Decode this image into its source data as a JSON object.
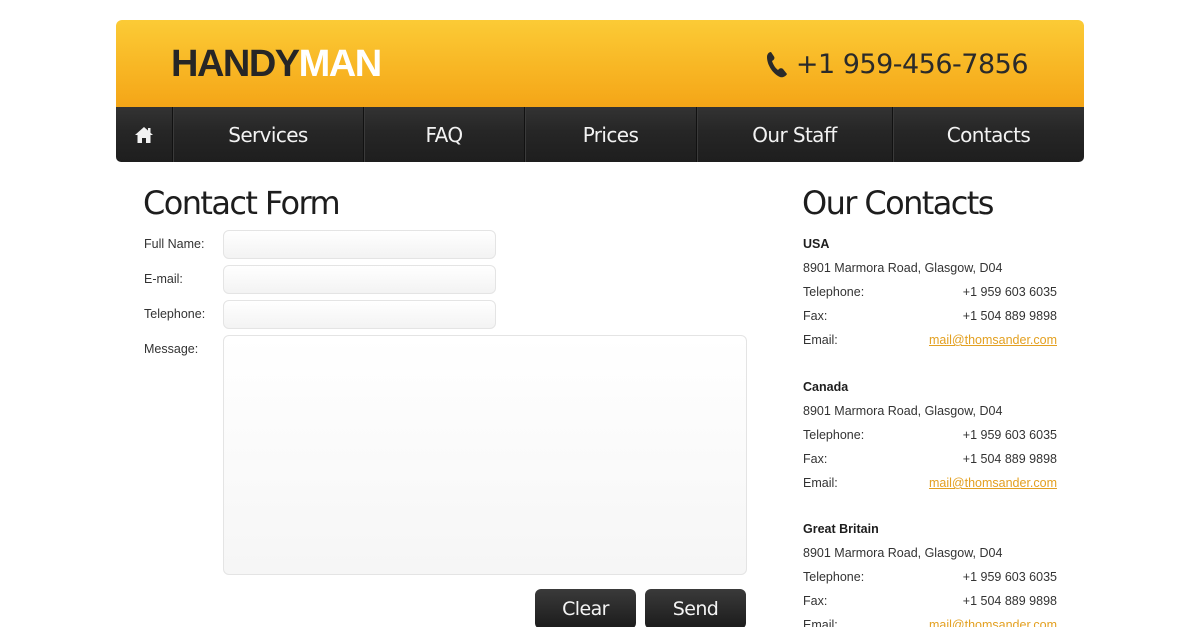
{
  "header": {
    "logo_dark": "HANDY",
    "logo_light": "MAN",
    "phone": "+1 959-456-7856"
  },
  "nav": {
    "home_icon": "home-icon",
    "items": [
      {
        "label": "Services"
      },
      {
        "label": "FAQ"
      },
      {
        "label": "Prices"
      },
      {
        "label": "Our Staff"
      },
      {
        "label": "Contacts"
      }
    ]
  },
  "form": {
    "title": "Contact Form",
    "full_name_label": "Full Name:",
    "email_label": "E-mail:",
    "telephone_label": "Telephone:",
    "message_label": "Message:",
    "full_name_value": "",
    "email_value": "",
    "telephone_value": "",
    "message_value": "",
    "clear_label": "Clear",
    "send_label": "Send"
  },
  "contacts": {
    "title": "Our Contacts",
    "telephone_label": "Telephone:",
    "fax_label": "Fax:",
    "email_label": "Email:",
    "regions": [
      {
        "name": "USA",
        "address": "8901 Marmora Road, Glasgow, D04",
        "telephone": "+1 959 603 6035",
        "fax": "+1 504 889 9898",
        "email": "mail@thomsander.com"
      },
      {
        "name": "Canada",
        "address": "8901 Marmora Road, Glasgow, D04",
        "telephone": "+1 959 603 6035",
        "fax": "+1 504 889 9898",
        "email": "mail@thomsander.com"
      },
      {
        "name": "Great Britain",
        "address": "8901 Marmora Road, Glasgow, D04",
        "telephone": "+1 959 603 6035",
        "fax": "+1 504 889 9898",
        "email": "mail@thomsander.com"
      }
    ]
  },
  "colors": {
    "header_top": "#fbcb36",
    "header_bottom": "#f4a517",
    "nav_bg": "#262626",
    "link": "#e3a021"
  }
}
